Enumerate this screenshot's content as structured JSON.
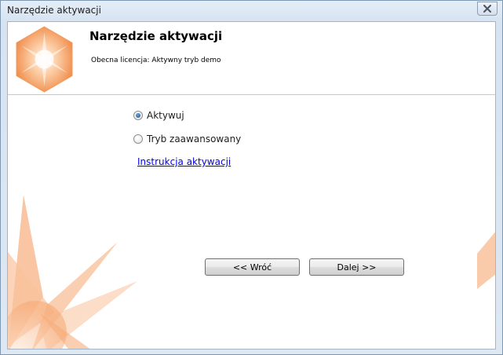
{
  "window": {
    "title": "Narzędzie aktywacji"
  },
  "header": {
    "title": "Narzędzie aktywacji",
    "subtitle": "Obecna licencja: Aktywny tryb demo"
  },
  "options": [
    {
      "label": "Aktywuj",
      "selected": true
    },
    {
      "label": "Tryb zaawansowany",
      "selected": false
    }
  ],
  "link": {
    "label": "Instrukcja aktywacji"
  },
  "buttons": {
    "back": "<< Wróć",
    "next": "Dalej >>"
  },
  "colors": {
    "accent_orange": "#f5a571",
    "link_blue": "#0000ee"
  }
}
